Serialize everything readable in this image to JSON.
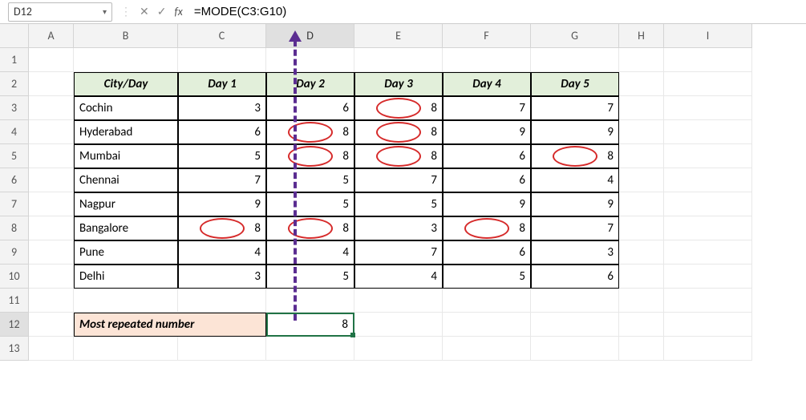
{
  "formula_bar": {
    "name_box": "D12",
    "formula": "=MODE(C3:G10)"
  },
  "columns": [
    "A",
    "B",
    "C",
    "D",
    "E",
    "F",
    "G",
    "H",
    "I"
  ],
  "rows": [
    "1",
    "2",
    "3",
    "4",
    "5",
    "6",
    "7",
    "8",
    "9",
    "10",
    "11",
    "12",
    "13"
  ],
  "headers": {
    "city_day": "City/Day",
    "day1": "Day 1",
    "day2": "Day 2",
    "day3": "Day 3",
    "day4": "Day 4",
    "day5": "Day 5"
  },
  "cities": [
    "Cochin",
    "Hyderabad",
    "Mumbai",
    "Chennai",
    "Nagpur",
    "Bangalore",
    "Pune",
    "Delhi"
  ],
  "label_most_repeated": "Most repeated number",
  "result_value": "8",
  "chart_data": {
    "type": "table",
    "title": "City/Day",
    "columns": [
      "Day 1",
      "Day 2",
      "Day 3",
      "Day 4",
      "Day 5"
    ],
    "rows": [
      "Cochin",
      "Hyderabad",
      "Mumbai",
      "Chennai",
      "Nagpur",
      "Bangalore",
      "Pune",
      "Delhi"
    ],
    "values": [
      [
        3,
        6,
        8,
        7,
        7
      ],
      [
        6,
        8,
        8,
        9,
        9
      ],
      [
        5,
        8,
        8,
        6,
        8
      ],
      [
        7,
        5,
        7,
        6,
        4
      ],
      [
        9,
        5,
        5,
        9,
        9
      ],
      [
        8,
        8,
        3,
        8,
        7
      ],
      [
        4,
        4,
        7,
        6,
        3
      ],
      [
        3,
        5,
        4,
        5,
        6
      ]
    ],
    "formula": "=MODE(C3:G10)",
    "mode_result": 8,
    "highlighted_cells": [
      {
        "row": "Cochin",
        "col": "Day 3"
      },
      {
        "row": "Hyderabad",
        "col": "Day 2"
      },
      {
        "row": "Hyderabad",
        "col": "Day 3"
      },
      {
        "row": "Mumbai",
        "col": "Day 2"
      },
      {
        "row": "Mumbai",
        "col": "Day 3"
      },
      {
        "row": "Mumbai",
        "col": "Day 5"
      },
      {
        "row": "Bangalore",
        "col": "Day 1"
      },
      {
        "row": "Bangalore",
        "col": "Day 2"
      },
      {
        "row": "Bangalore",
        "col": "Day 4"
      }
    ]
  },
  "data": {
    "r3": {
      "c": "3",
      "d": "6",
      "e": "8",
      "f": "7",
      "g": "7"
    },
    "r4": {
      "c": "6",
      "d": "8",
      "e": "8",
      "f": "9",
      "g": "9"
    },
    "r5": {
      "c": "5",
      "d": "8",
      "e": "8",
      "f": "6",
      "g": "8"
    },
    "r6": {
      "c": "7",
      "d": "5",
      "e": "7",
      "f": "6",
      "g": "4"
    },
    "r7": {
      "c": "9",
      "d": "5",
      "e": "5",
      "f": "9",
      "g": "9"
    },
    "r8": {
      "c": "8",
      "d": "8",
      "e": "3",
      "f": "8",
      "g": "7"
    },
    "r9": {
      "c": "4",
      "d": "4",
      "e": "7",
      "f": "6",
      "g": "3"
    },
    "r10": {
      "c": "3",
      "d": "5",
      "e": "4",
      "f": "5",
      "g": "6"
    }
  }
}
